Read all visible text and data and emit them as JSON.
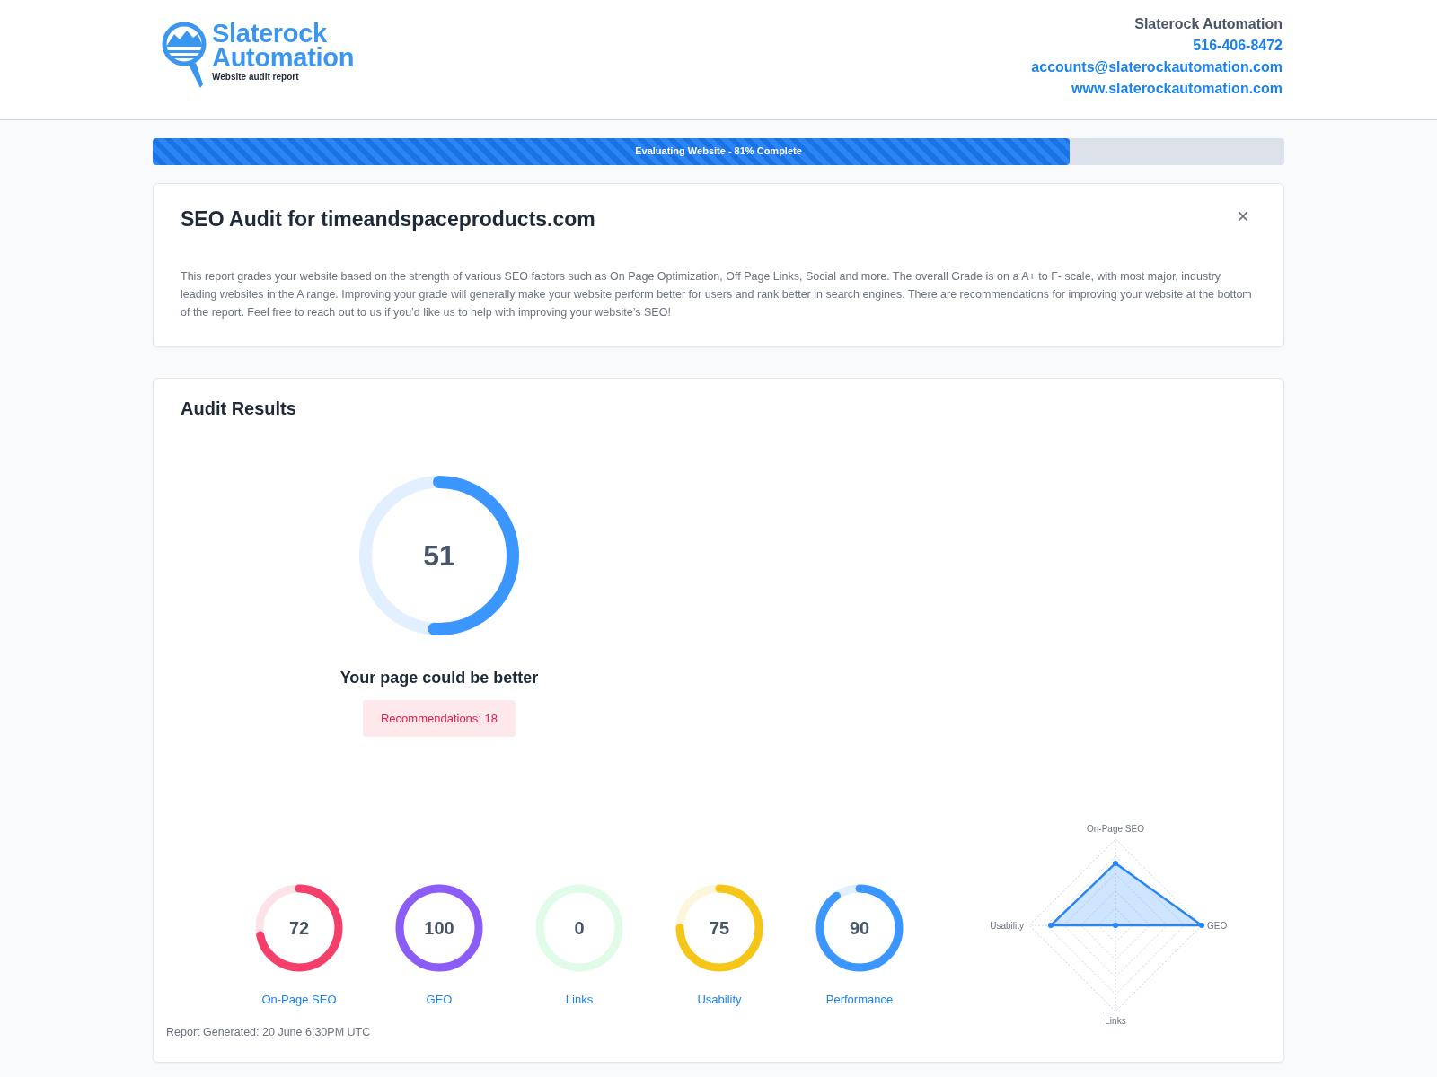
{
  "header": {
    "logo": {
      "line_1": "Slaterock",
      "line_2": "Automation",
      "tagline": "Website audit report"
    },
    "company": "Slaterock Automation",
    "phone": "516-406-8472",
    "email": "accounts@slaterockautomation.com",
    "website": "www.slaterockautomation.com"
  },
  "progress": {
    "label": "Evaluating Website - 81% Complete",
    "level": 0.81
  },
  "intro": {
    "title": "SEO Audit for timeandspaceproducts.com",
    "close": "×",
    "text": "This report grades your website based on the strength of various SEO factors such as On Page Optimization, Off Page Links, Social and more. The overall Grade is on a A+ to F- scale, with most major, industry leading websites in the A range. Improving your grade will generally make your website perform better for users and rank better in search engines. There are recommendations for improving your website at the bottom of the report. Feel free to reach out to us if you’d like us to help with improving your website’s SEO!"
  },
  "results": {
    "title": "Audit Results",
    "overall": {
      "score": "51",
      "verdict": "Your page could be better",
      "recommendations": "Recommendations: 18"
    },
    "gauges": [
      {
        "score": "72",
        "label": "On-Page SEO",
        "color": "#f43f6b"
      },
      {
        "score": "100",
        "label": "GEO",
        "color": "#8b5cf6"
      },
      {
        "score": "0",
        "label": "Links",
        "color": "#e1fbe9"
      },
      {
        "score": "75",
        "label": "Usability",
        "color": "#f5c518"
      },
      {
        "score": "90",
        "label": "Performance",
        "color": "#3b96ff"
      }
    ],
    "radar_labels": [
      "On-Page SEO",
      "GEO",
      "Links",
      "Usability"
    ],
    "footer": "Report Generated: 20 June 6:30PM UTC"
  }
}
